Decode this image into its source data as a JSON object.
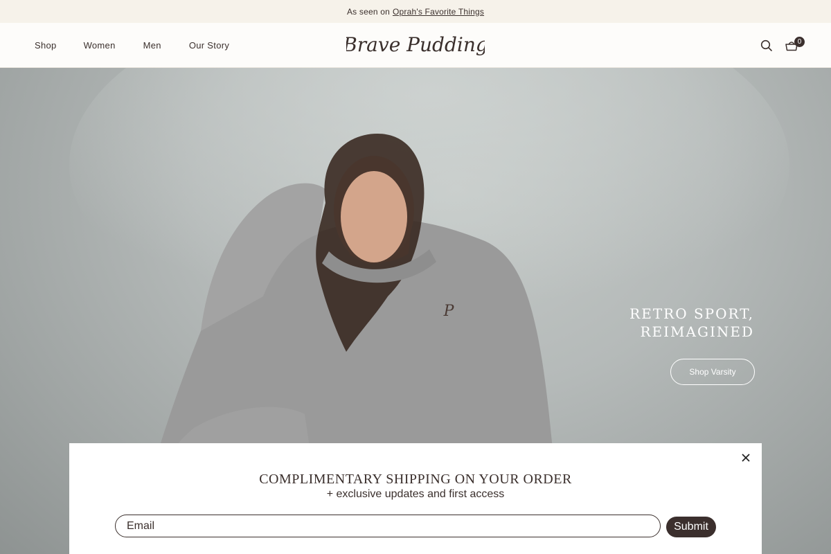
{
  "announcement": {
    "prefix": "As seen on",
    "link_label": "Oprah's Favorite Things"
  },
  "header": {
    "nav": [
      "Shop",
      "Women",
      "Men",
      "Our Story"
    ],
    "logo_text": "Brave Pudding",
    "cart_count": "0"
  },
  "hero": {
    "title_line1": "RETRO SPORT,",
    "title_line2": "REIMAGINED",
    "cta_label": "Shop Varsity"
  },
  "modal": {
    "title": "COMPLIMENTARY SHIPPING ON YOUR ORDER",
    "subtitle": "+ exclusive updates and first access",
    "email_placeholder": "Email",
    "submit_label": "Submit"
  },
  "colors": {
    "brand_dark": "#3b2f2d",
    "announcement_bg": "#f6f2ea",
    "hero_bg": "#b5bab9"
  }
}
